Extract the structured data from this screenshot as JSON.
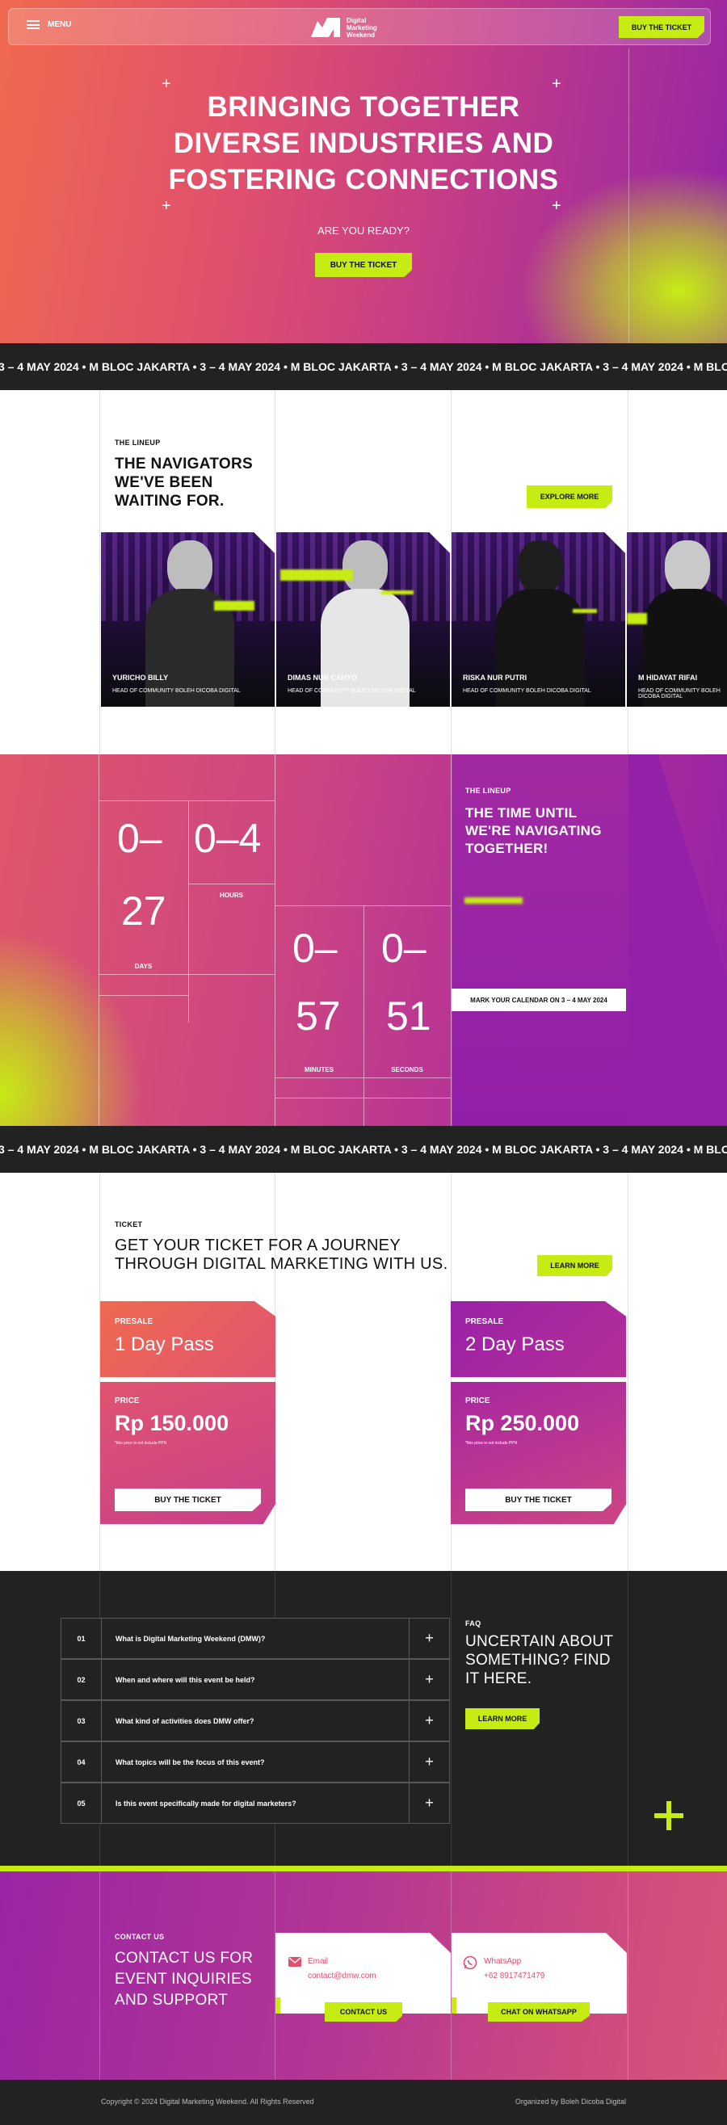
{
  "nav": {
    "menu_label": "MENU",
    "logo_text_1": "Digital",
    "logo_text_2": "Marketing",
    "logo_text_3": "Weekend",
    "cta_label": "BUY THE TICKET"
  },
  "hero": {
    "title_1": "BRINGING TOGETHER",
    "title_2": "DIVERSE INDUSTRIES AND",
    "title_3": "FOSTERING CONNECTIONS",
    "subtitle": "ARE YOU READY?",
    "cta_label": "BUY THE TICKET"
  },
  "marquee": {
    "text": "3 – 4 MAY 2024 • M BLOC JAKARTA • 3 – 4 MAY 2024 • M BLOC JAKARTA • 3 – 4 MAY 2024 • M BLOC JAKARTA • 3 – 4 MAY 2024 • M BLOC JAKARTA • 3 – 4 MAY 2024 • M BLOC JAKARTA •"
  },
  "lineup": {
    "eyebrow": "THE LINEUP",
    "heading_1": "THE NAVIGATORS",
    "heading_2": "WE'VE BEEN",
    "heading_3": "WAITING FOR.",
    "explore_label": "EXPLORE MORE",
    "speakers": [
      {
        "name": "YURICHO BILLY",
        "role": "HEAD OF COMMUNITY BOLEH DICOBA DIGITAL"
      },
      {
        "name": "DIMAS NUR CAHYO",
        "role": "HEAD OF COMMUNITY BOLEH DICOBA DIGITAL"
      },
      {
        "name": "RISKA NUR PUTRI",
        "role": "HEAD OF COMMUNITY BOLEH DICOBA DIGITAL"
      },
      {
        "name": "M HIDAYAT RIFAI",
        "role": "HEAD OF COMMUNITY BOLEH DICOBA DIGITAL"
      }
    ]
  },
  "countdown": {
    "days_1": "0–",
    "days_2": "27",
    "days_label": "DAYS",
    "hours": "0–4",
    "hours_label": "HOURS",
    "minutes_1": "0–",
    "minutes_2": "57",
    "minutes_label": "MINUTES",
    "seconds_1": "0–",
    "seconds_2": "51",
    "seconds_label": "SECONDS",
    "eyebrow": "THE LINEUP",
    "heading_1": "THE TIME UNTIL",
    "heading_2": "WE'RE NAVIGATING",
    "heading_3": "TOGETHER!",
    "calendar_label": "MARK YOUR CALENDAR ON 3 – 4 MAY 2024"
  },
  "tickets": {
    "eyebrow": "TICKET",
    "heading_1": "GET YOUR TICKET FOR A JOURNEY",
    "heading_2": "THROUGH DIGITAL MARKETING WITH US.",
    "learn_label": "LEARN MORE",
    "passes": [
      {
        "presale": "PRESALE",
        "name": "1 Day Pass",
        "price_label": "PRICE",
        "price": "Rp 150.000",
        "note": "*this price is not include PPN",
        "button": "BUY THE TICKET"
      },
      {
        "presale": "PRESALE",
        "name": "2 Day Pass",
        "price_label": "PRICE",
        "price": "Rp 250.000",
        "note": "*this price is not include PPN",
        "button": "BUY THE TICKET"
      }
    ]
  },
  "faq": {
    "eyebrow": "FAQ",
    "heading_1": "UNCERTAIN ABOUT",
    "heading_2": "SOMETHING? FIND",
    "heading_3": "IT HERE.",
    "learn_label": "LEARN MORE",
    "items": [
      {
        "no": "01",
        "q": "What is Digital Marketing Weekend (DMW)?"
      },
      {
        "no": "02",
        "q": "When and where will this event be held?"
      },
      {
        "no": "03",
        "q": "What kind of activities does DMW offer?"
      },
      {
        "no": "04",
        "q": "What topics will be the focus of this event?"
      },
      {
        "no": "05",
        "q": "Is this event specifically made for digital marketers?"
      }
    ]
  },
  "contact": {
    "eyebrow": "CONTACT US",
    "heading_1": "CONTACT US FOR",
    "heading_2": "EVENT INQUIRIES",
    "heading_3": "AND SUPPORT",
    "email_title": "Email",
    "email_value": "contact@dmw.com",
    "email_button": "CONTACT US",
    "wa_title": "WhatsApp",
    "wa_value": "+62 8917471479",
    "wa_button": "CHAT ON WHATSAPP"
  },
  "footer": {
    "copyright": "Copyright © 2024 Digital Marketing Weekend. All Rights Reserved",
    "organizer": "Organized by Boleh Dicoba Digital"
  },
  "colors": {
    "lime": "#c6ec14",
    "coral": "#f0694f",
    "purple": "#9424a6",
    "dark": "#222222"
  }
}
